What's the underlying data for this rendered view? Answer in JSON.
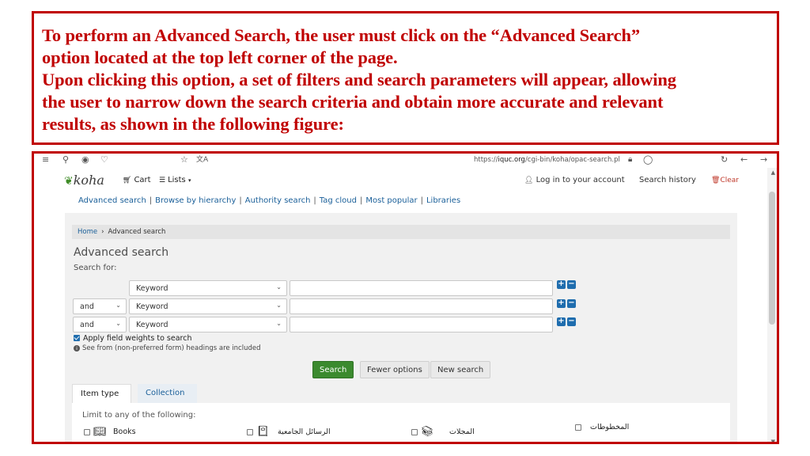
{
  "caption": {
    "line1": "To perform an Advanced Search, the user must click on the “Advanced Search”",
    "line2": "option located at the top left corner of the page.",
    "line3": "Upon clicking this option, a set of filters and search parameters will appear, allowing",
    "line4": "the user to narrow down the search criteria and obtain more accurate and relevant",
    "line5": "results, as shown in the following figure:"
  },
  "browser": {
    "url_prefix": "https://",
    "url_domain": "iquc.org",
    "url_path": "/cgi-bin/koha/opac-search.pl"
  },
  "header": {
    "logo_text": "koha",
    "cart_label": "Cart",
    "lists_label": "Lists",
    "login_label": "Log in to your account",
    "search_history_label": "Search history",
    "clear_label": "Clear"
  },
  "mastnav": {
    "items": [
      "Advanced search",
      "Browse by hierarchy",
      "Authority search",
      "Tag cloud",
      "Most popular",
      "Libraries"
    ]
  },
  "breadcrumb": {
    "home": "Home",
    "current": "Advanced search"
  },
  "search": {
    "title": "Advanced search",
    "search_for": "Search for:",
    "rows": [
      {
        "operator": "",
        "index": "Keyword",
        "value": ""
      },
      {
        "operator": "and",
        "index": "Keyword",
        "value": ""
      },
      {
        "operator": "and",
        "index": "Keyword",
        "value": ""
      }
    ],
    "apply_weights": "Apply field weights to search",
    "see_from_note": "See from (non-preferred form) headings are included",
    "buttons": {
      "search": "Search",
      "fewer_options": "Fewer options",
      "new_search": "New search"
    }
  },
  "tabs": {
    "item_type": "Item type",
    "collection": "Collection"
  },
  "limits": {
    "title": "Limit to any of the following:",
    "items": [
      "Books",
      "الرسائل الجامعية",
      "المجلات",
      "المخطوطات"
    ]
  },
  "colors": {
    "caption_red": "#c00000",
    "link_blue": "#1a5f99",
    "search_green": "#3b8a2e"
  }
}
